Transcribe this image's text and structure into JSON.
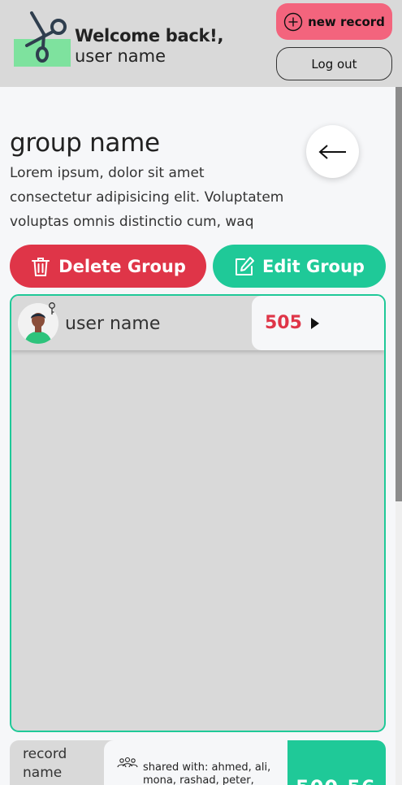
{
  "header": {
    "welcome": "Welcome back!,",
    "user_name": "user name",
    "new_record_label": "new record",
    "logout_label": "Log out"
  },
  "group": {
    "title": "group name",
    "description": "Lorem ipsum, dolor sit amet consectetur adipisicing elit. Voluptatem voluptas omnis distinctio cum, waq",
    "delete_label": "Delete Group",
    "edit_label": "Edit Group"
  },
  "members": [
    {
      "name": "user name",
      "amount": "505",
      "role": "admin"
    }
  ],
  "record": {
    "name": "record name",
    "shared_with": "shared with:  ahmed, ali, mona, rashad, peter,",
    "amount": "500.56"
  },
  "colors": {
    "accent_green": "#1fc998",
    "danger_red": "#df3548",
    "new_record_pink": "#f3647d"
  }
}
